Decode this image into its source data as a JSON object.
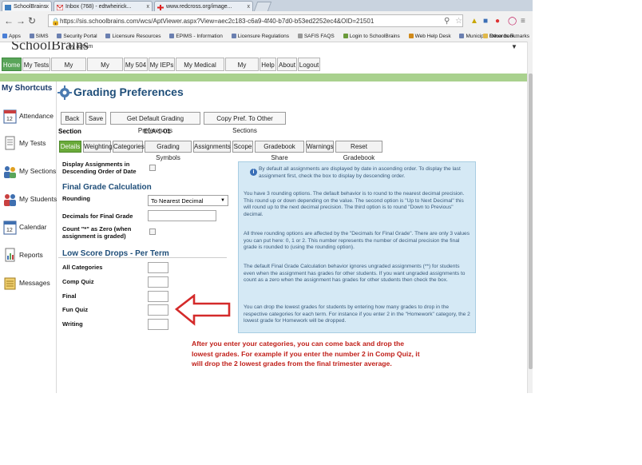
{
  "browser": {
    "tabs": [
      {
        "title": "SchoolBrains",
        "active": true
      },
      {
        "title": "Inbox (768) - edtwheirick...",
        "active": false
      },
      {
        "title": "www.redcross.org/image...",
        "active": false
      }
    ],
    "tab_close_glyph": "x",
    "url": "https://sis.schoolbrains.com/wcs/AptViewer.aspx?View=aec2c183-c6a9-4f40-b7d0-b53ed2252ec4&OID=21501",
    "bookmarks": [
      "Apps",
      "SIMS",
      "Security Portal",
      "Licensure Resources",
      "EPIMS - Information",
      "Licensure Regulations",
      "SAFIS FAQS",
      "Login to SchoolBrains",
      "Web Help Desk",
      "Municipal Records R..."
    ],
    "other_bookmarks": "Other bookmarks"
  },
  "logo": {
    "name": "SchoolBrains",
    "by": "by aptium"
  },
  "menu": [
    "Home",
    "My Tests",
    "My Sections",
    "My Students",
    "My 504",
    "My IEPs",
    "My Medical Plans",
    "My Account",
    "Help",
    "About",
    "Logout"
  ],
  "sidebar": {
    "title": "My Shortcuts",
    "items": [
      {
        "label": "Attendance",
        "icon": "calendar-icon"
      },
      {
        "label": "My Tests",
        "icon": "document-icon"
      },
      {
        "label": "My Sections",
        "icon": "people-icon"
      },
      {
        "label": "My Students",
        "icon": "students-icon"
      },
      {
        "label": "Calendar",
        "icon": "calendar-icon"
      },
      {
        "label": "Reports",
        "icon": "report-icon"
      },
      {
        "label": "Messages",
        "icon": "messages-icon"
      }
    ]
  },
  "page": {
    "title": "Grading Preferences",
    "buttons": [
      "Back",
      "Save",
      "Get Default Grading Preferences",
      "Copy Pref. To Other Sections"
    ],
    "section_label": "Section",
    "section_value": "ELA-1-01",
    "subtabs": [
      "Details",
      "Weighting",
      "Categories",
      "Grading Symbols",
      "Assignments",
      "Scope",
      "Gradebook Share",
      "Warnings",
      "Reset Gradebook"
    ],
    "display_desc_label": "Display Assignments in Descending Order of Date",
    "final_grade_heading": "Final Grade Calculation",
    "rounding_label": "Rounding",
    "rounding_value": "To Nearest Decimal",
    "decimals_label": "Decimals for Final Grade",
    "count_zero_label": "Count \"*\" as Zero (when assignment is graded)",
    "low_score_heading": "Low Score Drops - Per Term",
    "categories": [
      "All Categories",
      "Comp Quiz",
      "Final",
      "Fun Quiz",
      "Writing"
    ]
  },
  "info": {
    "p1": "By default all assignments are displayed by date in ascending order. To display the last assignment first, check the box to display by descending order.",
    "p2": "You have 3 rounding options. The default behavior is to round to the nearest decimal precision. This round up or down depending on the value. The second option is \"Up to Next Decimal\" this will round up to the next decimal precision. The third option is to round \"Down to Previous\" decimal.",
    "p3": "All three rounding options are affected by the \"Decimals for Final Grade\". There are only 3 values you can put here: 0, 1 or 2. This number represents the number of decimal precision the final grade is rounded to (using the rounding option).",
    "p4": "The default Final Grade Calculation behavior ignores ungraded assignments (**) for students even when the assignment has grades for other students. If you want ungraded assignments to count as a zero when the assignment has grades for other students then check the box.",
    "p5": "You can drop the lowest grades for students by entering how many grades to drop in the respective categories for each term. For instance if you enter 2 in the \"Homework\" category, the 2 lowest grade for Homework will be dropped."
  },
  "annotation": "After you enter your categories, you can come back and drop the lowest grades. For example if you enter the number 2 in Comp Quiz, it will drop the 2 lowest grades from the final trimester average.",
  "colors": {
    "menu_active": "#5aa55a",
    "subtab_active": "#6aaa3a",
    "heading": "#1f4e79",
    "info_bg": "#d5e9f5",
    "annotation": "#c0201a",
    "arrow": "#d42a2a"
  }
}
